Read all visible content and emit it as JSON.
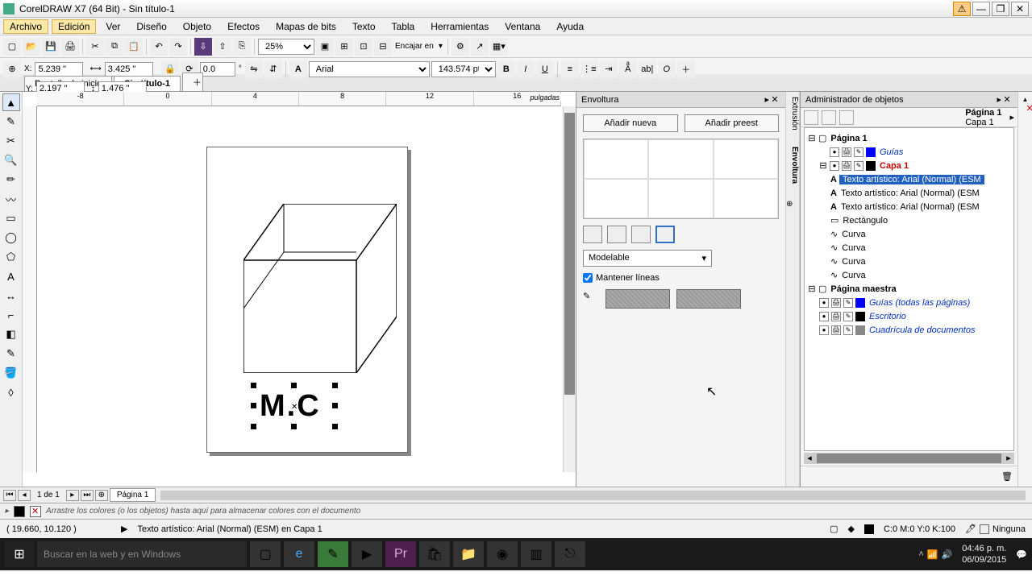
{
  "window": {
    "title": "CorelDRAW X7 (64 Bit) - Sin título-1"
  },
  "menu": {
    "archivo": "Archivo",
    "edicion": "Edición",
    "ver": "Ver",
    "diseno": "Diseño",
    "objeto": "Objeto",
    "efectos": "Efectos",
    "mapas": "Mapas de bits",
    "texto": "Texto",
    "tabla": "Tabla",
    "herramientas": "Herramientas",
    "ventana": "Ventana",
    "ayuda": "Ayuda"
  },
  "toolbar": {
    "zoom": "25%",
    "encajar": "Encajar en"
  },
  "props": {
    "x": "5.239 \"",
    "y": "2.197 \"",
    "w": "3.425 \"",
    "h": "1.476 \"",
    "rot": "0.0",
    "font": "Arial",
    "size": "143.574 pt"
  },
  "tabs": {
    "home": "Pantalla de inicio",
    "doc": "Sin título-1"
  },
  "ruler": {
    "unit": "pulgadas",
    "marks": [
      "-8",
      "0",
      "4",
      "8",
      "12",
      "16"
    ]
  },
  "canvas_text": "M.C",
  "envoltura": {
    "title": "Envoltura",
    "add": "Añadir nueva",
    "preset": "Añadir preest",
    "mode": "Modelable",
    "keep": "Mantener líneas"
  },
  "vtabs": {
    "extrusion": "Extrusión",
    "envoltura": "Envoltura"
  },
  "objmgr": {
    "title": "Administrador de objetos",
    "head1": "Página 1",
    "head2": "Capa 1",
    "page": "Página 1",
    "guias": "Guías",
    "capa": "Capa 1",
    "txtSel": "Texto artístico: Arial (Normal) (ESM",
    "txt": "Texto artístico: Arial (Normal) (ESM",
    "rect": "Rectángulo",
    "curva": "Curva",
    "master": "Página maestra",
    "guiasAll": "Guías (todas las páginas)",
    "escritorio": "Escritorio",
    "grid": "Cuadrícula de documentos"
  },
  "pagenav": {
    "count": "1 de 1",
    "page": "Página 1"
  },
  "colorhint": "Arrastre los colores (o los objetos) hasta aquí para almacenar colores con el documento",
  "status": {
    "coord": "( 19.660, 10.120 )",
    "sel": "Texto artístico: Arial (Normal) (ESM) en Capa 1",
    "cmyk": "C:0 M:0 Y:0 K:100",
    "none": "Ninguna"
  },
  "taskbar": {
    "search": "Buscar en la web y en Windows",
    "time": "04:46 p. m.",
    "date": "06/09/2015"
  },
  "colors": [
    "#000",
    "#fff",
    "#00f",
    "#0ff",
    "#0f0",
    "#ff0",
    "#f80",
    "#f00",
    "#f0f",
    "#808",
    "#884400",
    "#ccc"
  ]
}
